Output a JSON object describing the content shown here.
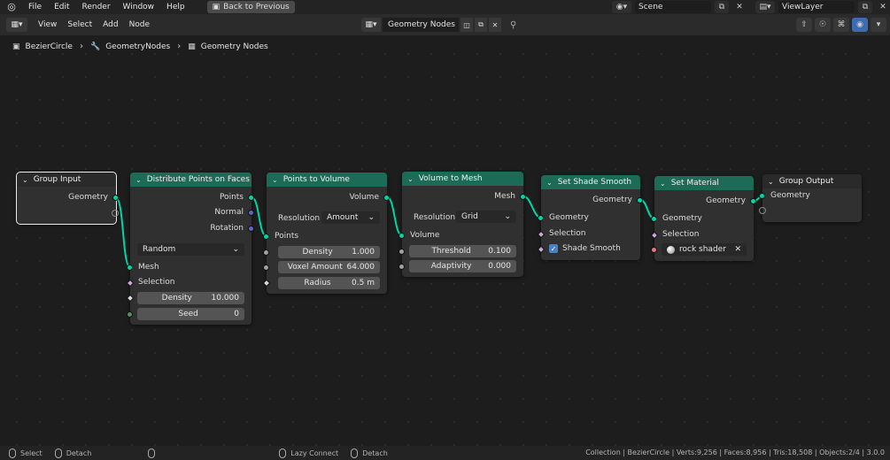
{
  "topbar": {
    "menus": [
      "File",
      "Edit",
      "Render",
      "Window",
      "Help"
    ],
    "back_button": "Back to Previous",
    "scene": "Scene",
    "view_layer": "ViewLayer"
  },
  "header": {
    "menus": [
      "View",
      "Select",
      "Add",
      "Node"
    ],
    "node_tree_name": "Geometry Nodes"
  },
  "breadcrumb": [
    "BezierCircle",
    "GeometryNodes",
    "Geometry Nodes"
  ],
  "nodes": {
    "group_input": {
      "title": "Group Input",
      "outputs": [
        "Geometry"
      ]
    },
    "distribute": {
      "title": "Distribute Points on Faces",
      "outputs": [
        "Points",
        "Normal",
        "Rotation"
      ],
      "mode": "Random",
      "inputs": [
        "Mesh",
        "Selection"
      ],
      "density_label": "Density",
      "density_value": "10.000",
      "seed_label": "Seed",
      "seed_value": "0"
    },
    "points_to_volume": {
      "title": "Points to Volume",
      "outputs": [
        "Volume"
      ],
      "resolution_label": "Resolution",
      "resolution_value": "Amount",
      "inputs": [
        "Points"
      ],
      "density_label": "Density",
      "density_value": "1.000",
      "voxel_label": "Voxel Amount",
      "voxel_value": "64.000",
      "radius_label": "Radius",
      "radius_value": "0.5 m"
    },
    "volume_to_mesh": {
      "title": "Volume to Mesh",
      "outputs": [
        "Mesh"
      ],
      "resolution_label": "Resolution",
      "resolution_value": "Grid",
      "inputs": [
        "Volume"
      ],
      "threshold_label": "Threshold",
      "threshold_value": "0.100",
      "adaptivity_label": "Adaptivity",
      "adaptivity_value": "0.000"
    },
    "shade_smooth": {
      "title": "Set Shade Smooth",
      "outputs": [
        "Geometry"
      ],
      "inputs": [
        "Geometry",
        "Selection"
      ],
      "shade_smooth_label": "Shade Smooth",
      "shade_smooth_checked": true
    },
    "set_material": {
      "title": "Set Material",
      "outputs": [
        "Geometry"
      ],
      "inputs": [
        "Geometry",
        "Selection"
      ],
      "material": "rock shader"
    },
    "group_output": {
      "title": "Group Output",
      "inputs": [
        "Geometry"
      ]
    }
  },
  "status": {
    "select": "Select",
    "detach1": "Detach",
    "lazy_connect": "Lazy Connect",
    "detach2": "Detach",
    "stats": "Collection | BezierCircle | Verts:9,256 | Faces:8,956 | Tris:18,508 | Objects:2/4 | 3.0.0"
  },
  "colors": {
    "node_header": "#1b6b57",
    "geometry_socket": "#00d6a3",
    "link": "#00d6a3",
    "canvas": "#1d1d1d"
  },
  "icons": [
    "blender-logo-icon",
    "back-icon",
    "scene-icon",
    "view-layer-icon",
    "node-editor-icon",
    "node-tree-icon",
    "shield-icon",
    "copy-icon",
    "close-icon",
    "pin-icon",
    "object-icon",
    "wrench-icon"
  ]
}
